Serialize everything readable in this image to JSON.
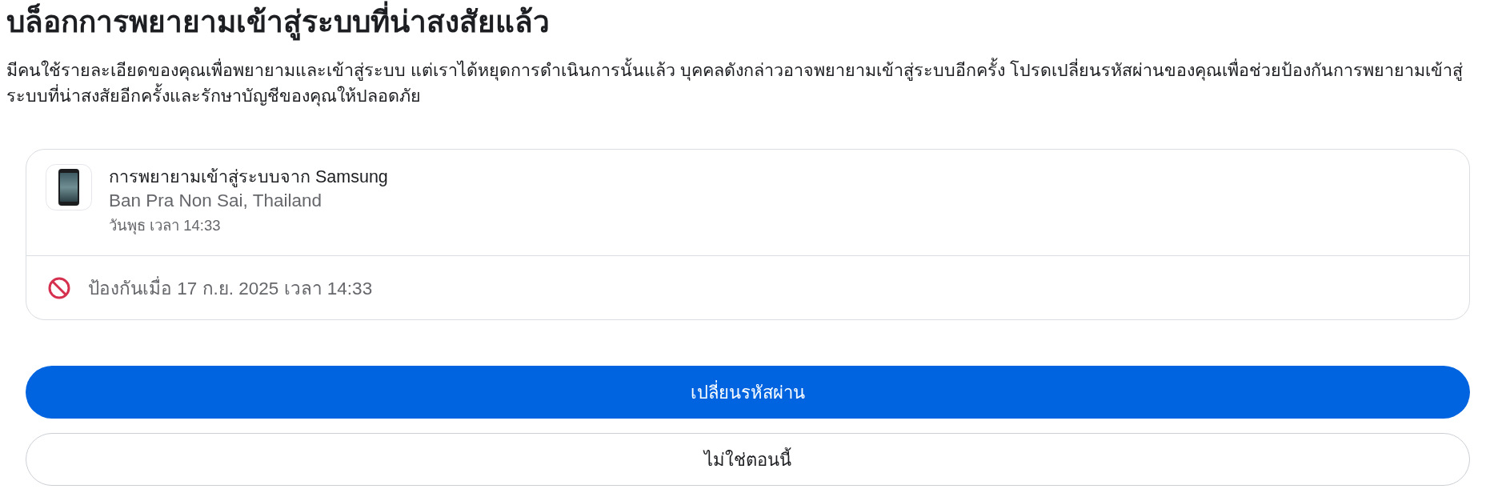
{
  "title": "บล็อกการพยายามเข้าสู่ระบบที่น่าสงสัยแล้ว",
  "description": "มีคนใช้รายละเอียดของคุณเพื่อพยายามและเข้าสู่ระบบ แต่เราได้หยุดการดำเนินการนั้นแล้ว บุคคลดังกล่าวอาจพยายามเข้าสู่ระบบอีกครั้ง โปรดเปลี่ยนรหัสผ่านของคุณเพื่อช่วยป้องกันการพยายามเข้าสู่ระบบที่น่าสงสัยอีกครั้งและรักษาบัญชีของคุณให้ปลอดภัย",
  "login_attempt": {
    "title": "การพยายามเข้าสู่ระบบจาก Samsung",
    "location": "Ban Pra Non Sai, Thailand",
    "time": "วันพุธ เวลา 14:33",
    "blocked_notice": "ป้องกันเมื่อ 17 ก.ย. 2025 เวลา 14:33"
  },
  "buttons": [
    {
      "label": "เปลี่ยนรหัสผ่าน",
      "kind": "primary"
    },
    {
      "label": "ไม่ใช่ตอนนี้",
      "kind": "secondary"
    }
  ]
}
